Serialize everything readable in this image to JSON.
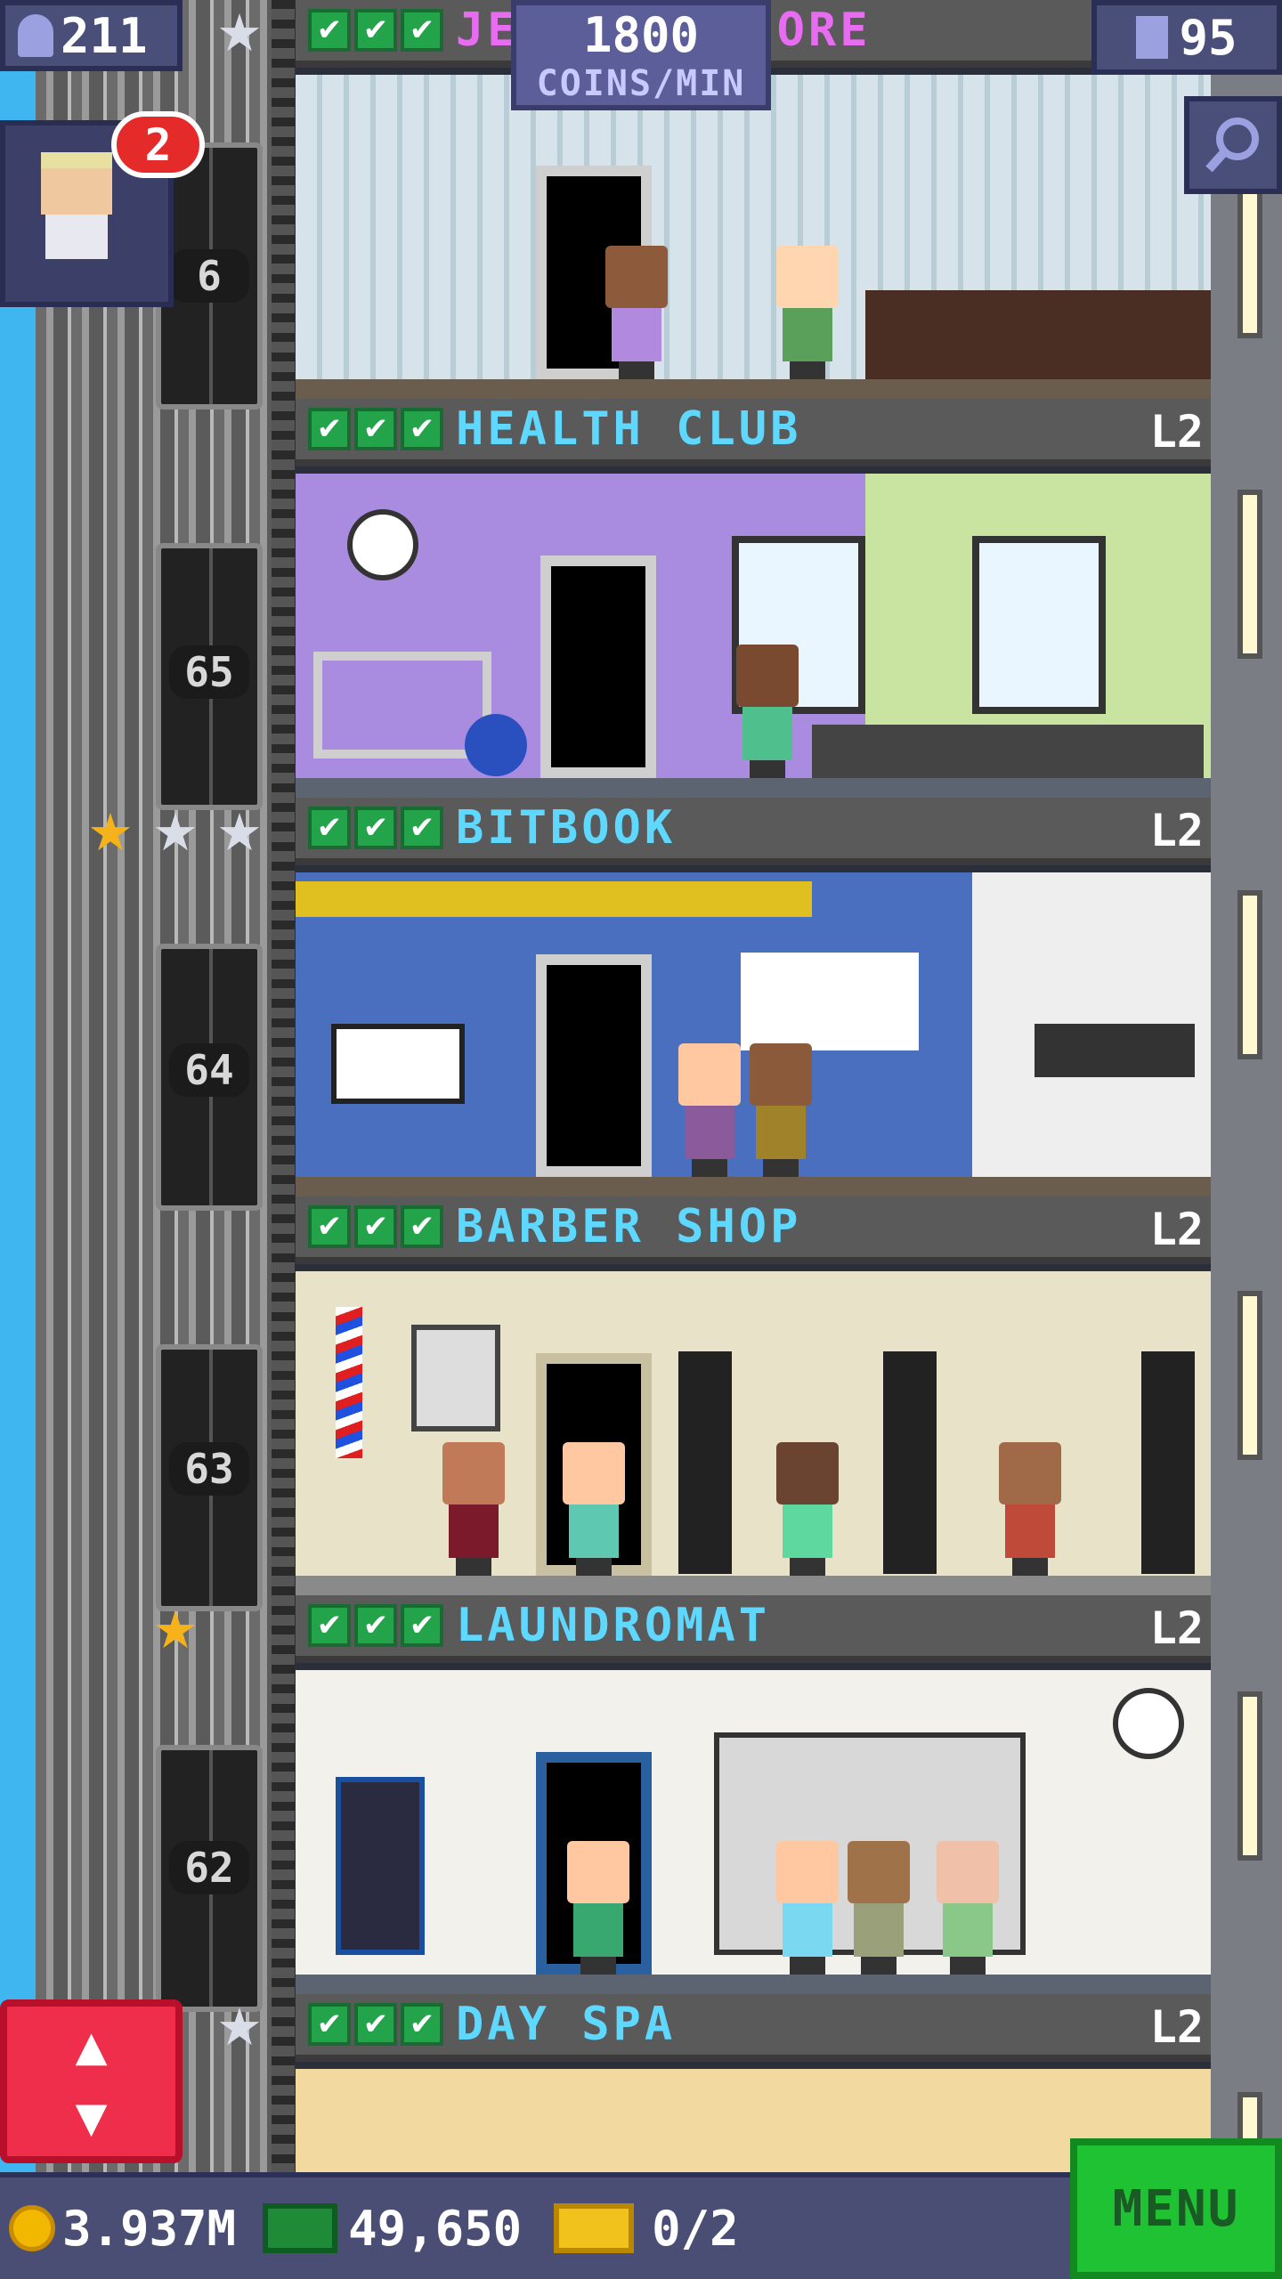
{
  "hud": {
    "population": "211",
    "coin_rate_value": "1800",
    "coin_rate_unit": "COINS/MIN",
    "floors_count": "95",
    "visitor_badge_count": "2"
  },
  "top_floor_partial": {
    "name_left": "JE",
    "name_right": "ORE"
  },
  "floors": [
    {
      "name": "HEALTH CLUB",
      "level": "L2",
      "checks": 3
    },
    {
      "name": "BITBOOK",
      "level": "L2",
      "checks": 3
    },
    {
      "name": "BARBER SHOP",
      "level": "L2",
      "checks": 3
    },
    {
      "name": "LAUNDROMAT",
      "level": "L2",
      "checks": 3
    },
    {
      "name": "DAY SPA",
      "level": "L2",
      "checks": 3
    }
  ],
  "elevator_floor_numbers": [
    "6",
    "65",
    "64",
    "63",
    "62"
  ],
  "check_glyph": "✔",
  "star_glyph": "★",
  "elevator_arrows": {
    "up": "▲",
    "down": "▼"
  },
  "bottom_bar": {
    "coins": "3.937M",
    "bux": "49,650",
    "tickets": "0/2",
    "menu_label": "MENU"
  },
  "colors": {
    "floor_name": "#5fd8ff",
    "check": "#23a34a",
    "menu_button": "#1fc233",
    "elevator_button": "#ee2e4a",
    "sky": "#3fb6ef"
  }
}
